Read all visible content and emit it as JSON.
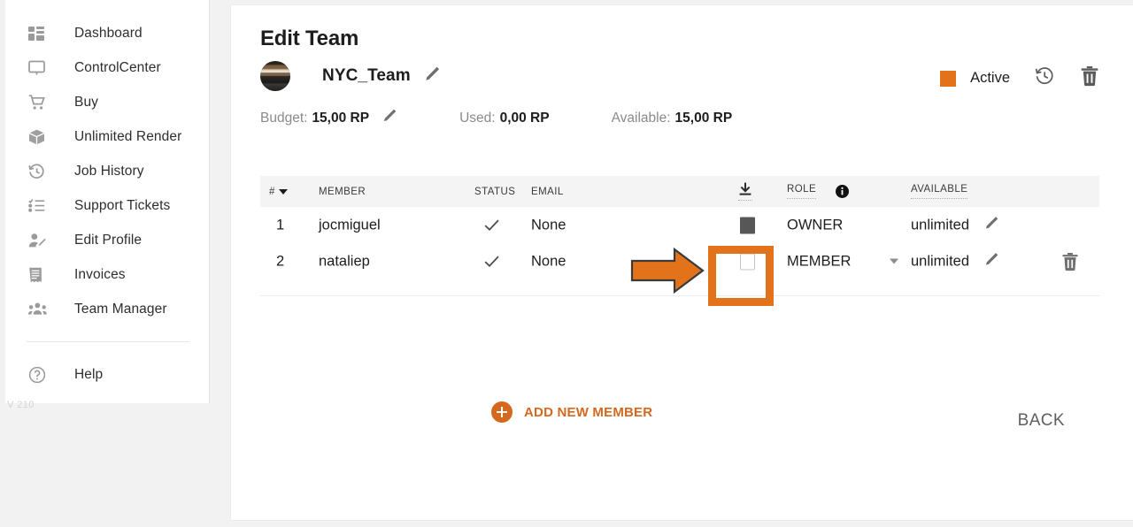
{
  "sidebar": {
    "items": [
      {
        "label": "Dashboard",
        "icon": "dashboard-icon"
      },
      {
        "label": "ControlCenter",
        "icon": "monitor-icon"
      },
      {
        "label": "Buy",
        "icon": "cart-icon"
      },
      {
        "label": "Unlimited Render",
        "icon": "box-icon"
      },
      {
        "label": "Job History",
        "icon": "history-icon"
      },
      {
        "label": "Support Tickets",
        "icon": "list-icon"
      },
      {
        "label": "Edit Profile",
        "icon": "user-edit-icon"
      },
      {
        "label": "Invoices",
        "icon": "invoice-icon"
      },
      {
        "label": "Team Manager",
        "icon": "users-icon"
      }
    ],
    "help": {
      "label": "Help",
      "icon": "help-circle-icon"
    },
    "version": "V 210"
  },
  "header": {
    "title": "Edit Team",
    "team_name": "NYC_Team",
    "team_name_edit_icon": "pencil-icon",
    "avatar": "team-avatar",
    "budget_label": "Budget:",
    "budget_value": "15,00 RP",
    "budget_edit_icon": "pencil-icon",
    "used_label": "Used:",
    "used_value": "0,00 RP",
    "available_label": "Available:",
    "available_value": "15,00 RP",
    "status_label": "Active",
    "status_color": "#e2731b",
    "history_icon": "clock-rewind-icon",
    "delete_icon": "trash-icon"
  },
  "table": {
    "headers": {
      "num": "#",
      "member": "MEMBER",
      "status": "STATUS",
      "email": "EMAIL",
      "download_icon": "download-icon",
      "role": "ROLE",
      "info_icon": "info-icon",
      "available": "AVAILABLE"
    },
    "rows": [
      {
        "num": "1",
        "member": "jocmiguel",
        "status_icon": "check-icon",
        "email": "None",
        "checkbox": "checked",
        "role": "OWNER",
        "role_has_dropdown": false,
        "available": "unlimited",
        "edit_icon": "pencil-icon",
        "delete_icon": null
      },
      {
        "num": "2",
        "member": "nataliep",
        "status_icon": "check-icon",
        "email": "None",
        "checkbox": "unchecked",
        "role": "MEMBER",
        "role_has_dropdown": true,
        "available": "unlimited",
        "edit_icon": "pencil-icon",
        "delete_icon": "trash-icon"
      }
    ]
  },
  "annotation": {
    "arrow": "orange-arrow-pointer",
    "box": "orange-highlight-box",
    "color": "#e2731b"
  },
  "footer": {
    "add_member_label": "ADD NEW MEMBER",
    "add_member_icon": "plus-circle-icon",
    "back_label": "BACK"
  }
}
